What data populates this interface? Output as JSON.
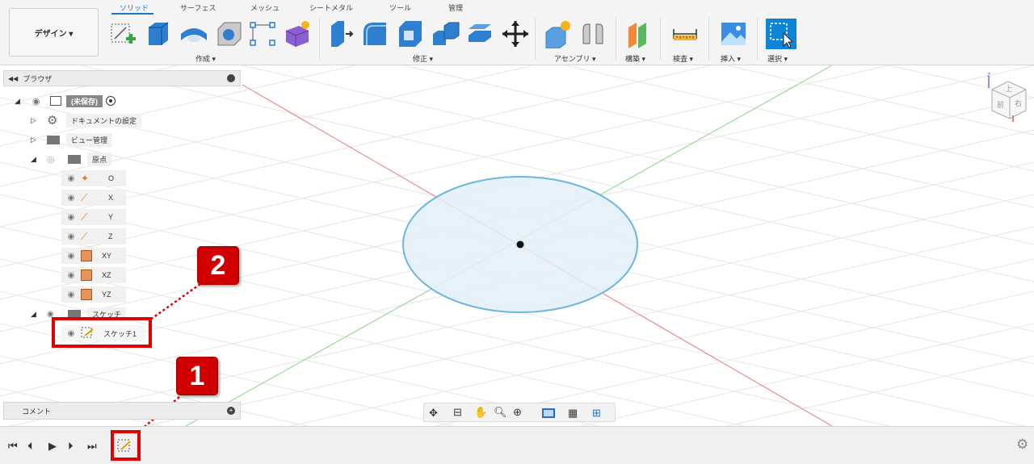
{
  "workspace": {
    "label": "デザイン ▾"
  },
  "tabs": [
    "ソリッド",
    "サーフェス",
    "メッシュ",
    "シートメタル",
    "ツール",
    "管理"
  ],
  "groups": {
    "create": "作成 ▾",
    "modify": "修正 ▾",
    "assemble": "アセンブリ ▾",
    "construct": "構築 ▾",
    "inspect": "検査 ▾",
    "insert": "挿入 ▾",
    "select": "選択 ▾"
  },
  "browser": {
    "title": "ブラウザ",
    "root": "(未保存)",
    "items": [
      {
        "label": "ドキュメントの設定"
      },
      {
        "label": "ビュー管理"
      },
      {
        "label": "原点"
      },
      {
        "label": "O"
      },
      {
        "label": "X"
      },
      {
        "label": "Y"
      },
      {
        "label": "Z"
      },
      {
        "label": "XY"
      },
      {
        "label": "XZ"
      },
      {
        "label": "YZ"
      },
      {
        "label": "スケッチ"
      },
      {
        "label": "スケッチ1"
      }
    ]
  },
  "comment": {
    "label": "コメント"
  },
  "viewcube": {
    "top": "上",
    "front": "前",
    "right": "右",
    "axis": "Z"
  },
  "callouts": {
    "one": "1",
    "two": "2"
  },
  "colors": {
    "accent": "#1a74c7",
    "callout": "#d10000",
    "circle_fill": "#e3eef8",
    "circle_stroke": "#6cb6df"
  }
}
